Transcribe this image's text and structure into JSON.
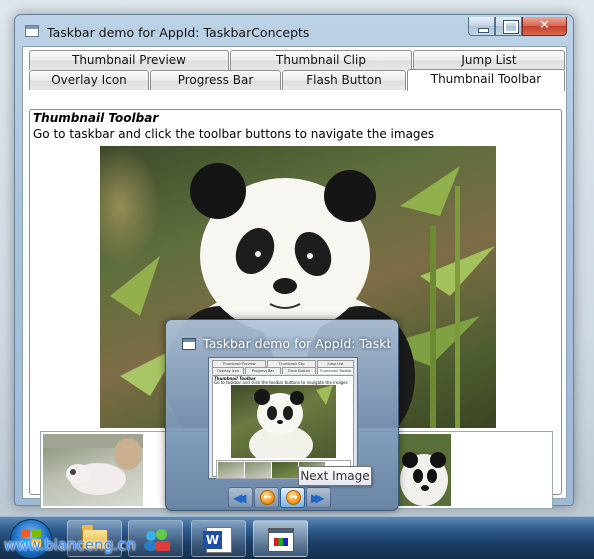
{
  "window": {
    "title": "Taskbar demo for AppId: TaskbarConcepts"
  },
  "tabs": {
    "row1": [
      "Thumbnail Preview",
      "Thumbnail Clip",
      "Jump List"
    ],
    "row2": [
      "Overlay Icon",
      "Progress Bar",
      "Flash Button",
      "Thumbnail Toolbar"
    ],
    "selected": "Thumbnail Toolbar"
  },
  "panel": {
    "heading": "Thumbnail Toolbar",
    "description": "Go to taskbar and click the toolbar buttons to navigate the images"
  },
  "images": {
    "main": "panda-image",
    "strip": [
      "baby-panda-thumbnail",
      "panda-thumbnail"
    ]
  },
  "preview": {
    "title": "Taskbar demo for AppId: Taskb",
    "toolbar_buttons": [
      "first-image-icon",
      "previous-image-icon",
      "next-image-icon",
      "last-image-icon"
    ],
    "tooltip": "Next Image"
  },
  "taskbar": {
    "apps": [
      "windows-explorer-icon",
      "windows-live-icon",
      "word-icon",
      "taskbar-demo-icon"
    ]
  },
  "watermark": "www.bianceng.cn",
  "colors": {
    "taskbar": "#1c3e66",
    "close_button": "#c4402a",
    "toolbar_arrow_blue": "#1f67c9",
    "toolbar_arrow_orange": "#f29a1a"
  }
}
